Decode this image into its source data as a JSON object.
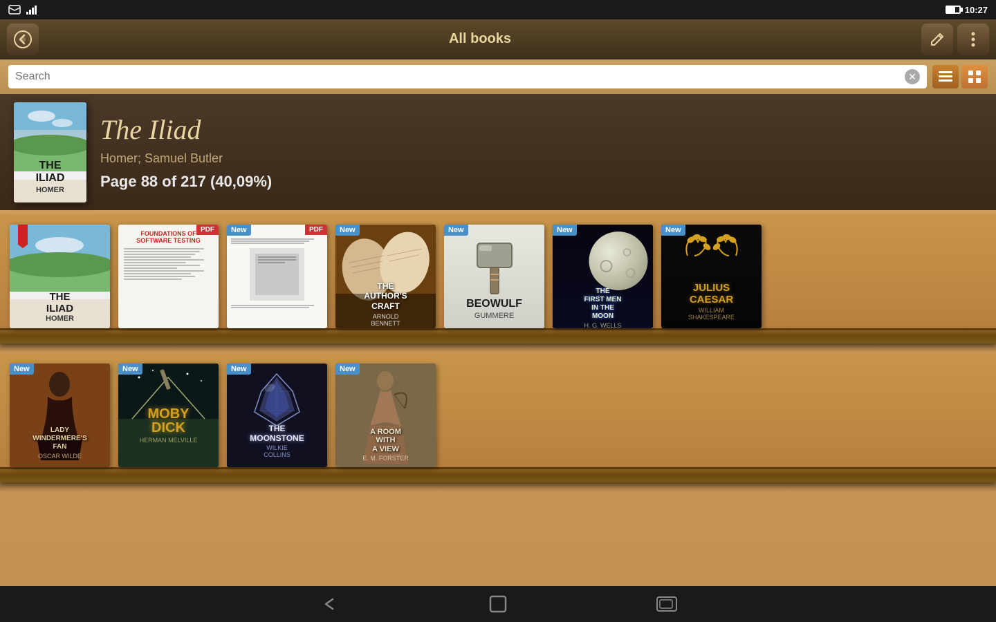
{
  "statusBar": {
    "time": "10:27",
    "batteryLevel": 70
  },
  "toolbar": {
    "title": "All books",
    "backLabel": "←",
    "editLabel": "✎",
    "menuLabel": "⋮"
  },
  "searchBar": {
    "placeholder": "Search",
    "listViewLabel": "≡",
    "gridViewLabel": "⊞"
  },
  "featuredBook": {
    "title": "The Iliad",
    "author": "Homer; Samuel Butler",
    "progress": "Page 88 of 217 (40,09%)"
  },
  "shelf1": {
    "books": [
      {
        "id": "iliad",
        "badge": "",
        "pdfBadge": "",
        "title": "THE\nILIAD",
        "author": "HOMER",
        "type": "iliad"
      },
      {
        "id": "foundations",
        "badge": "",
        "pdfBadge": "PDF",
        "title": "FOUNDATIONS OF SOFTWARE TESTING",
        "author": "",
        "type": "foundations"
      },
      {
        "id": "abstract",
        "badge": "New",
        "pdfBadge": "PDF",
        "title": "",
        "author": "",
        "type": "abstract"
      },
      {
        "id": "authors-craft",
        "badge": "New",
        "pdfBadge": "",
        "title": "THE\nAUTHOR'S\nCRAFT",
        "author": "ARNOLD\nBENNETT",
        "type": "authors-craft"
      },
      {
        "id": "beowulf",
        "badge": "New",
        "pdfBadge": "",
        "title": "BEOWULF",
        "author": "GUMMERE",
        "type": "beowulf"
      },
      {
        "id": "first-men",
        "badge": "New",
        "pdfBadge": "",
        "title": "THE\nFIRST MEN\nIN THE\nMOON",
        "author": "H. G. WELLS",
        "type": "first-men"
      },
      {
        "id": "julius-caesar",
        "badge": "New",
        "pdfBadge": "",
        "title": "JULIUS\nCAESAR",
        "author": "WILLIAM\nSHAKESPEARE",
        "type": "julius"
      }
    ]
  },
  "shelf2": {
    "books": [
      {
        "id": "lady-windermere",
        "badge": "New",
        "pdfBadge": "",
        "title": "LADY\nWINDERMERE'S\nFAN",
        "author": "OSCAR WILDE",
        "type": "lady"
      },
      {
        "id": "moby-dick",
        "badge": "New",
        "pdfBadge": "",
        "title": "MOBY\nDICK",
        "author": "HERMAN MELVILLE",
        "type": "moby"
      },
      {
        "id": "moonstone",
        "badge": "New",
        "pdfBadge": "",
        "title": "THE\nMOONSTONE",
        "author": "WILKIE\nCOLLINS",
        "type": "moonstone"
      },
      {
        "id": "room-with-view",
        "badge": "New",
        "pdfBadge": "",
        "title": "A ROOM\nWITH\nA VIEW",
        "author": "E. M. FORSTER",
        "type": "room"
      }
    ]
  },
  "navBar": {
    "backIcon": "←",
    "homeIcon": "⬜",
    "recentIcon": "▭"
  }
}
